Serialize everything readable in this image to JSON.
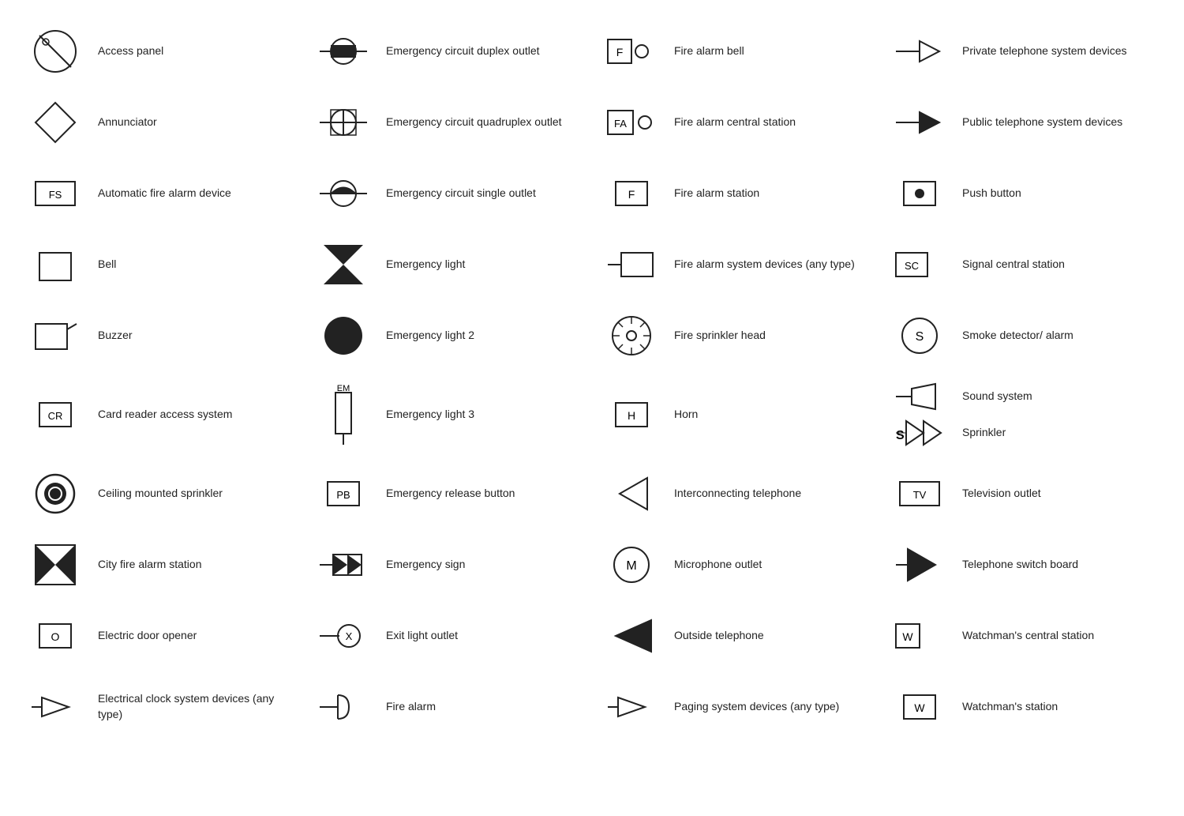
{
  "items": [
    {
      "id": "access-panel",
      "label": "Access panel",
      "col": 0,
      "row": 0
    },
    {
      "id": "emergency-circuit-duplex",
      "label": "Emergency circuit duplex outlet",
      "col": 1,
      "row": 0
    },
    {
      "id": "fire-alarm-bell",
      "label": "Fire alarm bell",
      "col": 2,
      "row": 0
    },
    {
      "id": "private-telephone",
      "label": "Private telephone system devices",
      "col": 3,
      "row": 0
    },
    {
      "id": "annunciator",
      "label": "Annunciator",
      "col": 0,
      "row": 1
    },
    {
      "id": "emergency-circuit-quadruplex",
      "label": "Emergency circuit quadruplex outlet",
      "col": 1,
      "row": 1
    },
    {
      "id": "fire-alarm-central",
      "label": "Fire alarm central station",
      "col": 2,
      "row": 1
    },
    {
      "id": "public-telephone",
      "label": "Public telephone system devices",
      "col": 3,
      "row": 1
    },
    {
      "id": "auto-fire-alarm",
      "label": "Automatic fire alarm device",
      "col": 0,
      "row": 2
    },
    {
      "id": "emergency-circuit-single",
      "label": "Emergency circuit single outlet",
      "col": 1,
      "row": 2
    },
    {
      "id": "fire-alarm-station",
      "label": "Fire alarm station",
      "col": 2,
      "row": 2
    },
    {
      "id": "push-button",
      "label": "Push button",
      "col": 3,
      "row": 2
    },
    {
      "id": "bell",
      "label": "Bell",
      "col": 0,
      "row": 3
    },
    {
      "id": "emergency-light",
      "label": "Emergency light",
      "col": 1,
      "row": 3
    },
    {
      "id": "fire-alarm-system-devices",
      "label": "Fire alarm system devices (any type)",
      "col": 2,
      "row": 3
    },
    {
      "id": "signal-central-station",
      "label": "Signal central station",
      "col": 3,
      "row": 3
    },
    {
      "id": "buzzer",
      "label": "Buzzer",
      "col": 0,
      "row": 4
    },
    {
      "id": "emergency-light-2",
      "label": "Emergency light 2",
      "col": 1,
      "row": 4
    },
    {
      "id": "fire-sprinkler-head",
      "label": "Fire sprinkler head",
      "col": 2,
      "row": 4
    },
    {
      "id": "smoke-detector",
      "label": "Smoke detector/ alarm",
      "col": 3,
      "row": 4
    },
    {
      "id": "card-reader",
      "label": "Card reader access system",
      "col": 0,
      "row": 5
    },
    {
      "id": "emergency-light-3",
      "label": "Emergency light 3",
      "col": 1,
      "row": 5
    },
    {
      "id": "horn",
      "label": "Horn",
      "col": 2,
      "row": 5
    },
    {
      "id": "sound-system",
      "label": "Sound system",
      "col": 3,
      "row": 5
    },
    {
      "id": "ceiling-sprinkler",
      "label": "Ceiling mounted sprinkler",
      "col": 0,
      "row": 6
    },
    {
      "id": "emergency-release",
      "label": "Emergency release button",
      "col": 1,
      "row": 6
    },
    {
      "id": "interconnecting-telephone",
      "label": "Interconnecting telephone",
      "col": 2,
      "row": 6
    },
    {
      "id": "television-outlet",
      "label": "Television outlet",
      "col": 3,
      "row": 6
    },
    {
      "id": "city-fire-alarm",
      "label": "City fire alarm station",
      "col": 0,
      "row": 7
    },
    {
      "id": "emergency-sign",
      "label": "Emergency sign",
      "col": 1,
      "row": 7
    },
    {
      "id": "microphone-outlet",
      "label": "Microphone outlet",
      "col": 2,
      "row": 7
    },
    {
      "id": "telephone-switchboard",
      "label": "Telephone switch board",
      "col": 3,
      "row": 7
    },
    {
      "id": "electric-door-opener",
      "label": "Electric door opener",
      "col": 0,
      "row": 8
    },
    {
      "id": "exit-light-outlet",
      "label": "Exit light outlet",
      "col": 1,
      "row": 8
    },
    {
      "id": "outside-telephone",
      "label": "Outside telephone",
      "col": 2,
      "row": 8
    },
    {
      "id": "watchmans-central",
      "label": "Watchman's central station",
      "col": 3,
      "row": 8
    },
    {
      "id": "electrical-clock",
      "label": "Electrical clock system devices (any type)",
      "col": 0,
      "row": 9
    },
    {
      "id": "fire-alarm-plain",
      "label": "Fire alarm",
      "col": 1,
      "row": 9
    },
    {
      "id": "paging-system",
      "label": "Paging system devices (any type)",
      "col": 2,
      "row": 9
    },
    {
      "id": "watchmans-station",
      "label": "Watchman's station",
      "col": 3,
      "row": 9
    },
    {
      "id": "sprinkler",
      "label": "Sprinkler",
      "col": 3,
      "row": 5
    }
  ]
}
